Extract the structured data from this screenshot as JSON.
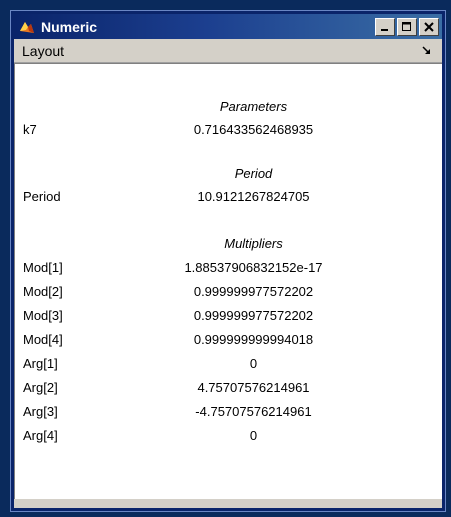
{
  "window": {
    "title": "Numeric",
    "icon": "matlab-icon",
    "buttons": [
      "minimize-icon",
      "maximize-icon",
      "close-icon"
    ]
  },
  "menu": {
    "layout_label": "Layout"
  },
  "sections": {
    "parameters": "Parameters",
    "period": "Period",
    "multipliers": "Multipliers"
  },
  "rows": {
    "k7": {
      "label": "k7",
      "value": "0.716433562468935"
    },
    "period": {
      "label": "Period",
      "value": "10.9121267824705"
    },
    "mod1": {
      "label": "Mod[1]",
      "value": "1.88537906832152e-17"
    },
    "mod2": {
      "label": "Mod[2]",
      "value": "0.999999977572202"
    },
    "mod3": {
      "label": "Mod[3]",
      "value": "0.999999977572202"
    },
    "mod4": {
      "label": "Mod[4]",
      "value": "0.999999999994018"
    },
    "arg1": {
      "label": "Arg[1]",
      "value": "0"
    },
    "arg2": {
      "label": "Arg[2]",
      "value": "4.75707576214961"
    },
    "arg3": {
      "label": "Arg[3]",
      "value": "-4.75707576214961"
    },
    "arg4": {
      "label": "Arg[4]",
      "value": "0"
    }
  }
}
